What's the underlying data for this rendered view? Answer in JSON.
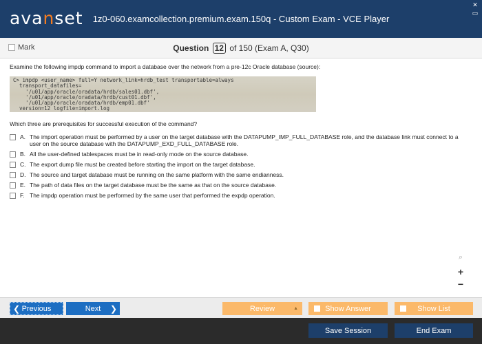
{
  "app": {
    "logo_main": "ava",
    "logo_dot": "n",
    "logo_rest": "set",
    "window_title": "1z0-060.examcollection.premium.exam.150q - Custom Exam - VCE Player",
    "win_close": "✕",
    "win_restore": "▭"
  },
  "question_header": {
    "mark_label": "Mark",
    "question_label": "Question",
    "question_number": "12",
    "of_text": "of 150 (Exam A, Q30)"
  },
  "content": {
    "intro": "Examine the following impdp command to import a database over the network from a pre-12c Oracle database (source):",
    "code_lines": "C> impdp <user_name> full=Y network_link=hrdb_test transportable=always\n  transport_datafiles=\n    '/u01/app/oracle/oradata/hrdb/sales01.dbf',\n    '/u01/app/oracle/oradata/hrdb/cust01.dbf',\n    '/u01/app/oracle/oradata/hrdb/emp01.dbf'\n  version=12 logfile=import.log",
    "question": "Which three are prerequisites for successful execution of the command?",
    "options": [
      {
        "letter": "A.",
        "text": "The import operation must be performed by a user on the target database with the DATAPUMP_IMP_FULL_DATABASE role, and the database link must connect to a user on the source database with the DATAPUMP_EXD_FULL_DATABASE role."
      },
      {
        "letter": "B.",
        "text": "All the user-defined tablespaces must be in read-only mode on the source database."
      },
      {
        "letter": "C.",
        "text": "The export dump file must be created before starting the import on the target database."
      },
      {
        "letter": "D.",
        "text": "The source and target database must be running on the same platform with the same endianness."
      },
      {
        "letter": "E.",
        "text": "The path of data files on the target database must be the same as that on the source database."
      },
      {
        "letter": "F.",
        "text": "The impdp operation must be performed by the same user that performed the expdp operation."
      }
    ]
  },
  "zoom": {
    "magnifier": "⌕",
    "plus": "+",
    "minus": "−"
  },
  "nav": {
    "previous": "Previous",
    "next": "Next",
    "review": "Review",
    "show_answer": "Show Answer",
    "show_list": "Show List",
    "prev_arrow": "❮",
    "next_arrow": "❯",
    "review_arrow": "▲"
  },
  "footer": {
    "save_session": "Save Session",
    "end_exam": "End Exam"
  }
}
